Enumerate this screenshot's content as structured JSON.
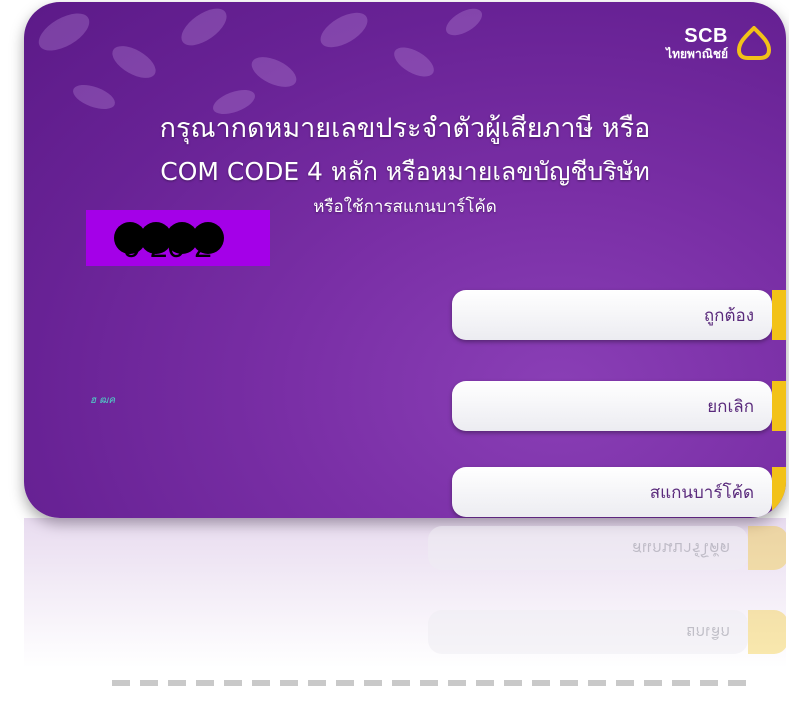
{
  "bank": {
    "name": "SCB",
    "thai_name": "ไทยพาณิชย์",
    "logo_icon": "scb-house-icon",
    "colors": {
      "screen": "#7a2fa6",
      "logo_gold": "#f2c218",
      "redaction": "#a400e8"
    }
  },
  "prompt": {
    "line1": "กรุณากดหมายเลขประจำตัวผู้เสียภาษี หรือ",
    "line2": "COM CODE 4 หลัก หรือหมายเลขบัญชีบริษัท",
    "line3": "หรือใช้การสแกนบาร์โค้ด"
  },
  "entry": {
    "masked_dots": 4,
    "code": "9 20 2"
  },
  "side_label": "ฮ ฒค",
  "buttons": {
    "confirm": "ถูกต้อง",
    "cancel": "ยกเลิก",
    "scan": "สแกนบาร์โค้ด"
  },
  "reflection": {
    "scan": "สแกนบาร์โค้ด",
    "cancel": "ยกเลิก"
  }
}
